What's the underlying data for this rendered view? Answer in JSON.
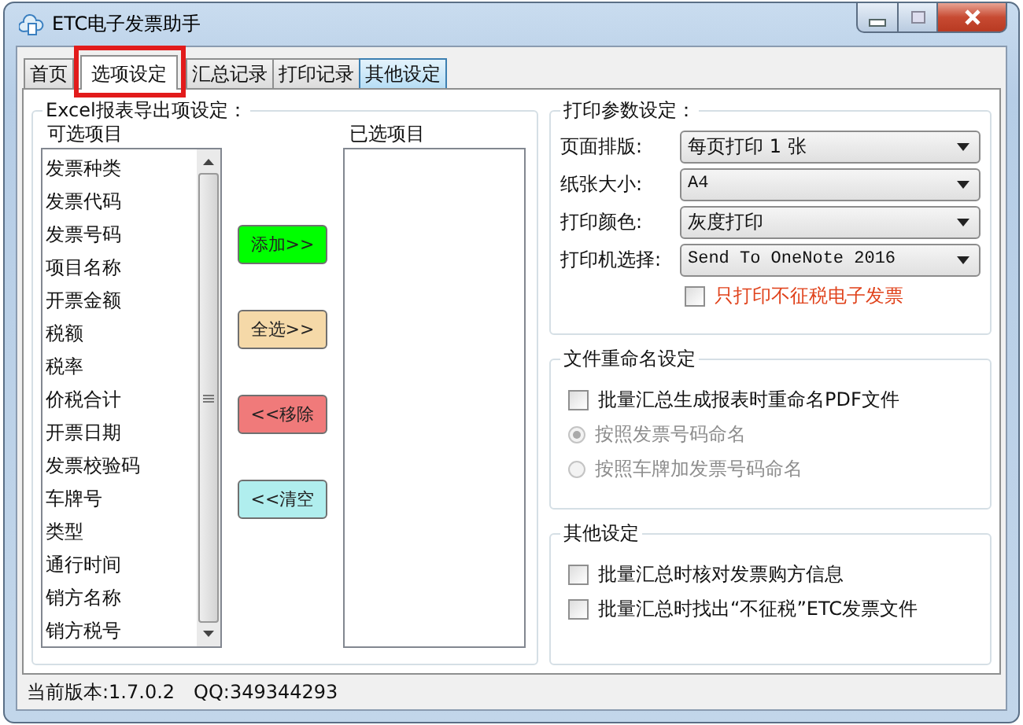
{
  "window": {
    "title": "ETC电子发票助手"
  },
  "tabs": [
    {
      "label": "首页",
      "selected": false,
      "hovered": false,
      "annotated": false
    },
    {
      "label": "选项设定",
      "selected": true,
      "hovered": false,
      "annotated": true
    },
    {
      "label": "汇总记录",
      "selected": false,
      "hovered": false,
      "annotated": false
    },
    {
      "label": "打印记录",
      "selected": false,
      "hovered": false,
      "annotated": false
    },
    {
      "label": "其他设定",
      "selected": false,
      "hovered": true,
      "annotated": false
    }
  ],
  "export": {
    "title": "Excel报表导出项设定：",
    "available_label": "可选项目",
    "selected_label": "已选项目",
    "available_items": [
      "发票种类",
      "发票代码",
      "发票号码",
      "项目名称",
      "开票金额",
      "税额",
      "税率",
      "价税合计",
      "开票日期",
      "发票校验码",
      "车牌号",
      "类型",
      "通行时间",
      "销方名称",
      "销方税号"
    ],
    "buttons": [
      {
        "label": "添加>>",
        "color": "#00ff00"
      },
      {
        "label": "全选>>",
        "color": "#f5d9a8"
      },
      {
        "label": "<<移除",
        "color": "#f07a7a"
      },
      {
        "label": "<<清空",
        "color": "#b0eeee"
      }
    ]
  },
  "print": {
    "title": "打印参数设定：",
    "fields": [
      {
        "label": "页面排版:",
        "value": "每页打印 1 张"
      },
      {
        "label": "纸张大小:",
        "value": "A4"
      },
      {
        "label": "打印颜色:",
        "value": "灰度打印"
      },
      {
        "label": "打印机选择:",
        "value": "Send To OneNote 2016"
      }
    ],
    "option": {
      "label": "只打印不征税电子发票",
      "checked": false
    }
  },
  "rename": {
    "title": "文件重命名设定",
    "checkbox": {
      "label": "批量汇总生成报表时重命名PDF文件",
      "checked": false
    },
    "radios": [
      {
        "label": "按照发票号码命名",
        "selected": true,
        "disabled": true
      },
      {
        "label": "按照车牌加发票号码命名",
        "selected": false,
        "disabled": true
      }
    ]
  },
  "other": {
    "title": "其他设定",
    "checkboxes": [
      {
        "label": "批量汇总时核对发票购方信息",
        "checked": false
      },
      {
        "label": "批量汇总时找出“不征税”ETC发票文件",
        "checked": false
      }
    ]
  },
  "status_bar": {
    "version": "当前版本:1.7.0.2",
    "qq": "QQ:349344293"
  }
}
